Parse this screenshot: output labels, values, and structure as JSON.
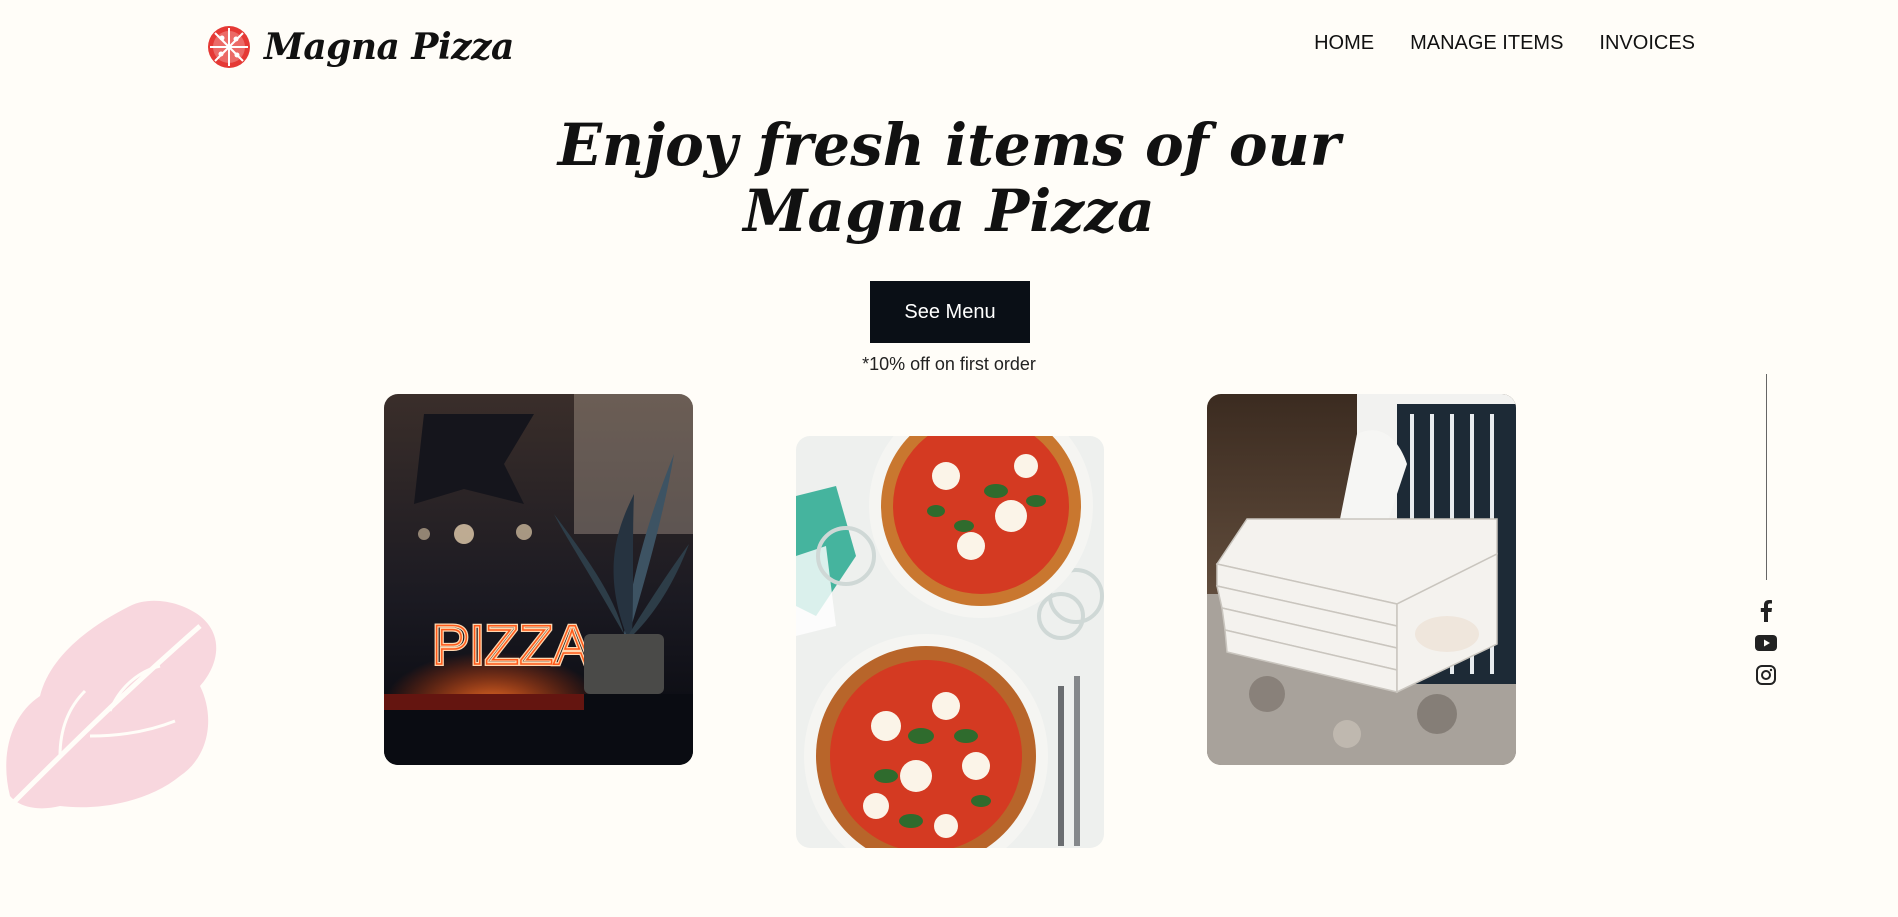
{
  "brand": {
    "name": "Magna Pizza",
    "logo_icon": "pizza-icon",
    "accent_color": "#e53935"
  },
  "nav": {
    "items": [
      {
        "label": "HOME"
      },
      {
        "label": "MANAGE ITEMS"
      },
      {
        "label": "INVOICES"
      }
    ]
  },
  "hero": {
    "title_line1": "Enjoy fresh items of our",
    "title_line2": "Magna Pizza",
    "cta_label": "See Menu",
    "offer_note": "*10% off on first order"
  },
  "gallery": [
    {
      "icon": "neon-pizza-sign-photo"
    },
    {
      "icon": "margherita-pizzas-photo"
    },
    {
      "icon": "pizza-boxes-photo"
    }
  ],
  "social": [
    {
      "icon": "facebook-icon"
    },
    {
      "icon": "youtube-icon"
    },
    {
      "icon": "instagram-icon"
    }
  ],
  "colors": {
    "background": "#fffdf8",
    "button": "#0a0f16",
    "leaf": "#f8d7de"
  }
}
